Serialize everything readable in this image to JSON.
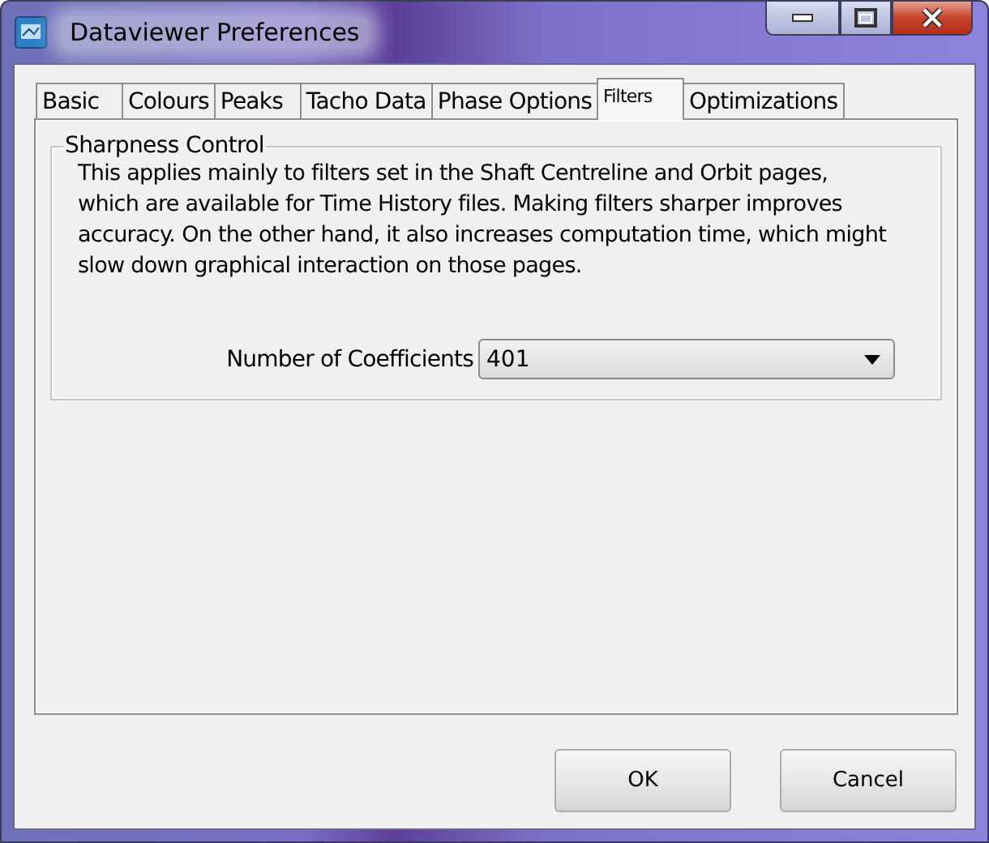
{
  "window": {
    "title": "Dataviewer Preferences"
  },
  "tabs": [
    {
      "label": "Basic",
      "selected": false
    },
    {
      "label": "Colours",
      "selected": false
    },
    {
      "label": "Peaks",
      "selected": false
    },
    {
      "label": "Tacho Data",
      "selected": false
    },
    {
      "label": "Phase Options",
      "selected": false
    },
    {
      "label": "Filters",
      "selected": true
    },
    {
      "label": "Optimizations",
      "selected": false
    }
  ],
  "group": {
    "title": "Sharpness Control",
    "description": "This applies mainly to filters set in the Shaft Centreline and Orbit pages, which are available for Time History files. Making filters sharper improves accuracy. On the other hand, it also increases computation time, which might slow down graphical interaction on those pages.",
    "field": {
      "label": "Number of Coefficients",
      "value": "401"
    }
  },
  "buttons": [
    "OK",
    "Cancel"
  ]
}
